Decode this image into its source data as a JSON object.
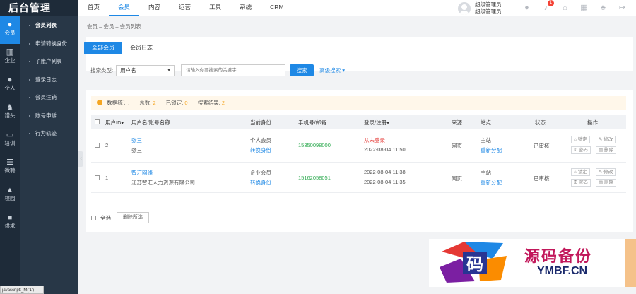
{
  "brand": "后台管理",
  "topnav": [
    {
      "label": "首页",
      "active": false
    },
    {
      "label": "会员",
      "active": true
    },
    {
      "label": "内容",
      "active": false
    },
    {
      "label": "运营",
      "active": false
    },
    {
      "label": "工具",
      "active": false
    },
    {
      "label": "系统",
      "active": false
    },
    {
      "label": "CRM",
      "active": false
    }
  ],
  "user": {
    "line1": "超级管理员",
    "line2": "超级管理员"
  },
  "notifications": "1",
  "iconbar": [
    {
      "label": "会员",
      "icon": "user-icon",
      "active": true
    },
    {
      "label": "企业",
      "icon": "building-icon",
      "active": false
    },
    {
      "label": "个人",
      "icon": "person-icon",
      "active": false
    },
    {
      "label": "猎头",
      "icon": "headhunter-icon",
      "active": false
    },
    {
      "label": "培训",
      "icon": "chat-icon",
      "active": false
    },
    {
      "label": "微聘",
      "icon": "stack-icon",
      "active": false
    },
    {
      "label": "校园",
      "icon": "graduation-icon",
      "active": false
    },
    {
      "label": "供求",
      "icon": "box-icon",
      "active": false
    }
  ],
  "subnav": [
    {
      "label": "会员列表",
      "active": true
    },
    {
      "label": "申请转换身份",
      "active": false
    },
    {
      "label": "子账户列表",
      "active": false
    },
    {
      "label": "登录日志",
      "active": false
    },
    {
      "label": "会员注销",
      "active": false
    },
    {
      "label": "账号申诉",
      "active": false
    },
    {
      "label": "行为轨迹",
      "active": false
    }
  ],
  "breadcrumb": "会员 – 会员 – 会员列表",
  "tabs": [
    "全部会员",
    "会员日志"
  ],
  "search": {
    "type_label": "搜索类型:",
    "type_value": "用户名",
    "placeholder": "请输入你要搜索的关键字",
    "button": "搜索",
    "advanced": "高级搜索"
  },
  "stats": {
    "label": "数据统计:",
    "total_label": "总数:",
    "total": "2",
    "locked_label": "已锁定:",
    "locked": "0",
    "result_label": "搜索结果:",
    "result": "2"
  },
  "columns": [
    "用户ID",
    "用户名/账号名称",
    "当前身份",
    "手机号/邮箱",
    "登录/注册",
    "来源",
    "站点",
    "状态",
    "操作"
  ],
  "rows": [
    {
      "id": "2",
      "name": "张三",
      "account": "张三",
      "identity": "个人会员",
      "switch": "转换身份",
      "phone": "15350098000",
      "login": "从未登录",
      "register": "2022-08-04 11:50",
      "source": "网页",
      "site": "主站",
      "reassign": "重新分配",
      "status": "已审核"
    },
    {
      "id": "1",
      "name": "智汇网络",
      "account": "江苏智汇人力资源有限公司",
      "identity": "企业会员",
      "switch": "转换身份",
      "phone": "15162058051",
      "login": "2022-08-04 11:38",
      "register": "2022-08-04 11:35",
      "source": "网页",
      "site": "主站",
      "reassign": "重新分配",
      "status": "已审核"
    }
  ],
  "ops": {
    "lock": "锁定",
    "edit": "修改",
    "password": "密码",
    "delete": "删除"
  },
  "footer": {
    "select_all": "全选",
    "delete_selected": "删除所选"
  },
  "statusbar": "javascript:_M('1')",
  "watermark": {
    "logo_char": "码",
    "title": "源码备份",
    "url": "YMBF.CN"
  },
  "colors": {
    "accent": "#1e88e5",
    "sidebar": "#1e2b39",
    "danger": "#e53935",
    "success": "#2eaa50",
    "warning": "#f5a623"
  }
}
